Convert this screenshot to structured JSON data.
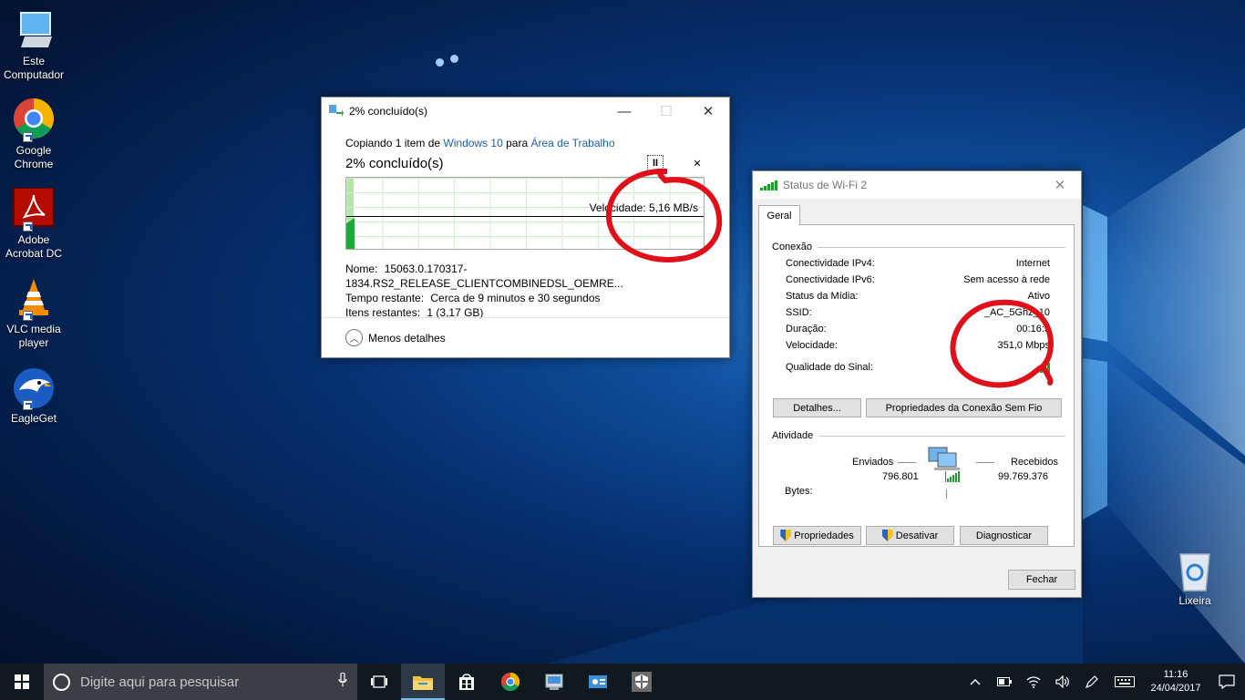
{
  "desktop": {
    "icons": [
      {
        "label": "Este\nComputador",
        "icon": "this-pc-icon"
      },
      {
        "label": "Google\nChrome",
        "icon": "chrome-icon"
      },
      {
        "label": "Adobe\nAcrobat DC",
        "icon": "acrobat-icon"
      },
      {
        "label": "VLC media\nplayer",
        "icon": "vlc-icon"
      },
      {
        "label": "EagleGet",
        "icon": "eagleget-icon"
      }
    ],
    "recycle_bin": {
      "label": "Lixeira",
      "icon": "recycle-bin-icon"
    }
  },
  "copy_dialog": {
    "title": "2% concluído(s)",
    "copying_prefix": "Copiando 1 item de ",
    "source": "Windows 10",
    "to_word": " para ",
    "destination": "Área de Trabalho",
    "percent_text": "2% concluído(s)",
    "progress_fraction": 0.02,
    "speed_text": "Velocidade: 5,16 MB/s",
    "name_label": "Nome:",
    "name_value": "15063.0.170317-1834.RS2_RELEASE_CLIENTCOMBINEDSL_OEMRE...",
    "time_label": "Tempo restante:",
    "time_value": "Cerca de 9 minutos e 30 segundos",
    "items_label": "Itens restantes:",
    "items_value": "1 (3,17 GB)",
    "less_details": "Menos detalhes",
    "pause_glyph": "II",
    "cancel_glyph": "✕"
  },
  "wifi_dialog": {
    "title": "Status de Wi-Fi 2",
    "tab": "Geral",
    "connection_group": "Conexão",
    "rows": [
      {
        "label": "Conectividade IPv4:",
        "value": "Internet"
      },
      {
        "label": "Conectividade IPv6:",
        "value": "Sem acesso à rede"
      },
      {
        "label": "Status da Mídia:",
        "value": "Ativo"
      },
      {
        "label": "SSID:",
        "value": "_AC_5Ghz_10"
      },
      {
        "label": "Duração:",
        "value": "00:16:5"
      },
      {
        "label": "Velocidade:",
        "value": "351,0 Mbps"
      }
    ],
    "signal_label": "Qualidade do Sinal:",
    "signal_bars": 5,
    "details_button": "Detalhes...",
    "wireless_props_button": "Propriedades da Conexão Sem Fio",
    "activity_group": "Atividade",
    "sent_label": "Enviados",
    "received_label": "Recebidos",
    "bytes_label": "Bytes:",
    "sent_value": "796.801",
    "received_value": "99.769.376",
    "properties_button": "Propriedades",
    "disable_button": "Desativar",
    "diagnose_button": "Diagnosticar",
    "close_button": "Fechar"
  },
  "taskbar": {
    "search_placeholder": "Digite aqui para pesquisar",
    "apps": [
      "task-view-icon",
      "file-explorer-icon",
      "store-icon",
      "chrome-icon",
      "app-icon",
      "app-icon",
      "security-icon"
    ],
    "time": "11:16",
    "date": "24/04/2017"
  },
  "colors": {
    "link": "#1a5fb4",
    "progress_green": "#1ea83a",
    "annotation_red": "#e0101a",
    "taskbar_bg": "#101820"
  }
}
